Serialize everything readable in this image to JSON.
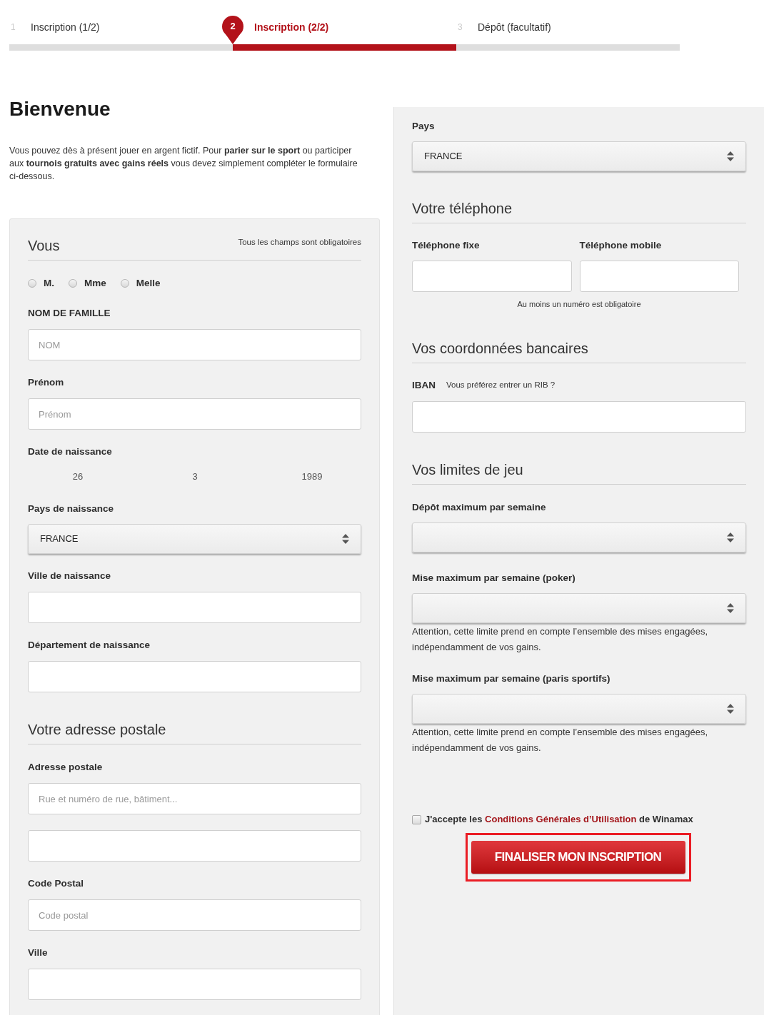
{
  "steps": [
    {
      "number": "1",
      "label": "Inscription (1/2)",
      "selected": false
    },
    {
      "number": "2",
      "label": "Inscription (2/2)",
      "selected": true
    },
    {
      "number": "3",
      "label": "Dépôt (facultatif)",
      "selected": false
    }
  ],
  "intro": {
    "title": "Bienvenue",
    "text": "Vous pouvez dès à présent jouer en argent fictif. Pour **parier sur le sport** ou participer aux **tournois gratuits avec gains réels** vous devez simplement compléter le formulaire ci-dessous."
  },
  "personal": {
    "title": "Vous",
    "note": "Tous les champs sont obligatoires",
    "civility": [
      {
        "label": "M.",
        "selected": false
      },
      {
        "label": "Mme",
        "selected": false
      },
      {
        "label": "Melle",
        "selected": false
      }
    ],
    "fields": [
      {
        "kind": "text",
        "label": "NOM DE FAMILLE",
        "placeholder": "NOM"
      },
      {
        "kind": "text",
        "label": "Prénom",
        "placeholder": "Prénom"
      },
      {
        "kind": "date",
        "label": "Date de naissance",
        "values": [
          "26",
          "3",
          "1989"
        ]
      },
      {
        "kind": "select",
        "label": "Pays de naissance",
        "value": "FRANCE"
      },
      {
        "kind": "text",
        "label": "Ville de naissance"
      },
      {
        "kind": "text",
        "label": "Département de naissance"
      }
    ]
  },
  "address": {
    "title": "Votre adresse postale",
    "fields": [
      {
        "kind": "text",
        "label": "Adresse postale",
        "placeholder": "Rue et numéro de rue, bâtiment..."
      },
      {
        "kind": "text"
      },
      {
        "kind": "text",
        "label": "Code Postal",
        "placeholder": "Code postal"
      },
      {
        "kind": "text",
        "label": "Ville"
      }
    ]
  },
  "country": {
    "label": "Pays",
    "value": "FRANCE"
  },
  "phone": {
    "title": "Votre téléphone",
    "fields": [
      {
        "label": "Téléphone fixe"
      },
      {
        "label": "Téléphone mobile"
      }
    ],
    "hint": "Au moins un numéro est obligatoire"
  },
  "bank": {
    "title": "Vos coordonnées bancaires",
    "label": "IBAN",
    "link": "Vous préférez entrer un RIB ?"
  },
  "limits": {
    "title": "Vos limites de jeu",
    "fields": [
      {
        "label": "Dépôt maximum par semaine"
      },
      {
        "label": "Mise maximum par semaine (poker)",
        "note": "Attention, cette limite prend en compte l’ensemble des mises engagées, indépendamment de vos gains."
      },
      {
        "label": "Mise maximum par semaine (paris sportifs)",
        "note": "Attention, cette limite prend en compte l’ensemble des mises engagées, indépendamment de vos gains."
      }
    ]
  },
  "terms": {
    "checked": false,
    "prefix": "J'accepte les",
    "link": "Conditions Générales d’Utilisation",
    "suffix": "de Winamax"
  },
  "submit": {
    "label": "FINALISER MON INSCRIPTION",
    "highlighted": true
  }
}
